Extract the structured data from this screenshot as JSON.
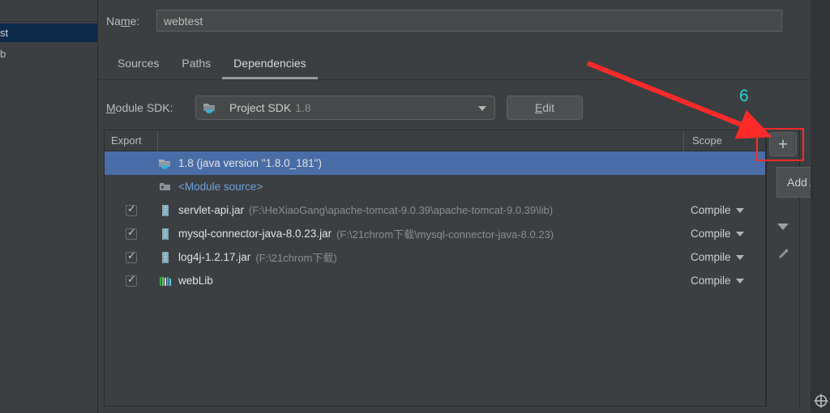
{
  "window": {
    "theme_bg": "#3c3f41",
    "selection_color": "#4a6da7",
    "link_color": "#6aa3e0",
    "annotation_color": "#29d7e0",
    "arrow_color": "#ff2a2a"
  },
  "sidebar": {
    "items": [
      {
        "label": "st",
        "selected": true
      },
      {
        "label": "b",
        "selected": false
      }
    ]
  },
  "name_field": {
    "label": "Name:",
    "label_prefix": "Na",
    "label_mnemonic": "m",
    "label_suffix": "e:",
    "value": "webtest",
    "placeholder": ""
  },
  "tabs": [
    {
      "label": "Sources",
      "active": false
    },
    {
      "label": "Paths",
      "active": false
    },
    {
      "label": "Dependencies",
      "active": true
    }
  ],
  "module_sdk": {
    "label": "Module SDK:",
    "label_mnemonic": "M",
    "label_rest": "odule SDK:",
    "selected": "Project SDK",
    "version": "1.8",
    "edit_button": "Edit",
    "edit_mnemonic": "E",
    "edit_rest": "dit"
  },
  "table": {
    "headers": {
      "export": "Export",
      "middle": "",
      "scope": "Scope"
    },
    "rows": [
      {
        "export_checkbox": null,
        "icon": "jdk-folder-icon",
        "name": "1.8 (java version \"1.8.0_181\")",
        "path": "",
        "scope": "",
        "selected": true,
        "style": "white"
      },
      {
        "export_checkbox": null,
        "icon": "module-source-icon",
        "name": "<Module source>",
        "path": "",
        "scope": "",
        "selected": false,
        "style": "link"
      },
      {
        "export_checkbox": true,
        "icon": "jar-icon",
        "name": "servlet-api.jar",
        "path": "(F:\\HeXiaoGang\\apache-tomcat-9.0.39\\apache-tomcat-9.0.39\\lib)",
        "scope": "Compile",
        "selected": false,
        "style": "white"
      },
      {
        "export_checkbox": true,
        "icon": "jar-icon",
        "name": "mysql-connector-java-8.0.23.jar",
        "path": "(F:\\21chrom下载\\mysql-connector-java-8.0.23)",
        "scope": "Compile",
        "selected": false,
        "style": "white"
      },
      {
        "export_checkbox": true,
        "icon": "jar-icon",
        "name": "log4j-1.2.17.jar",
        "path": "(F:\\21chrom下载)",
        "scope": "Compile",
        "selected": false,
        "style": "white"
      },
      {
        "export_checkbox": true,
        "icon": "library-icon",
        "name": "webLib",
        "path": "",
        "scope": "Compile",
        "selected": false,
        "style": "white"
      }
    ]
  },
  "toolbar": {
    "add_button": "+",
    "move_down_icon": "chevron-down-icon",
    "edit_icon": "pencil-icon"
  },
  "tooltip": {
    "text": "Add  Al"
  },
  "annotation": {
    "step_number": "6"
  },
  "status_icon": "crosshair-icon"
}
